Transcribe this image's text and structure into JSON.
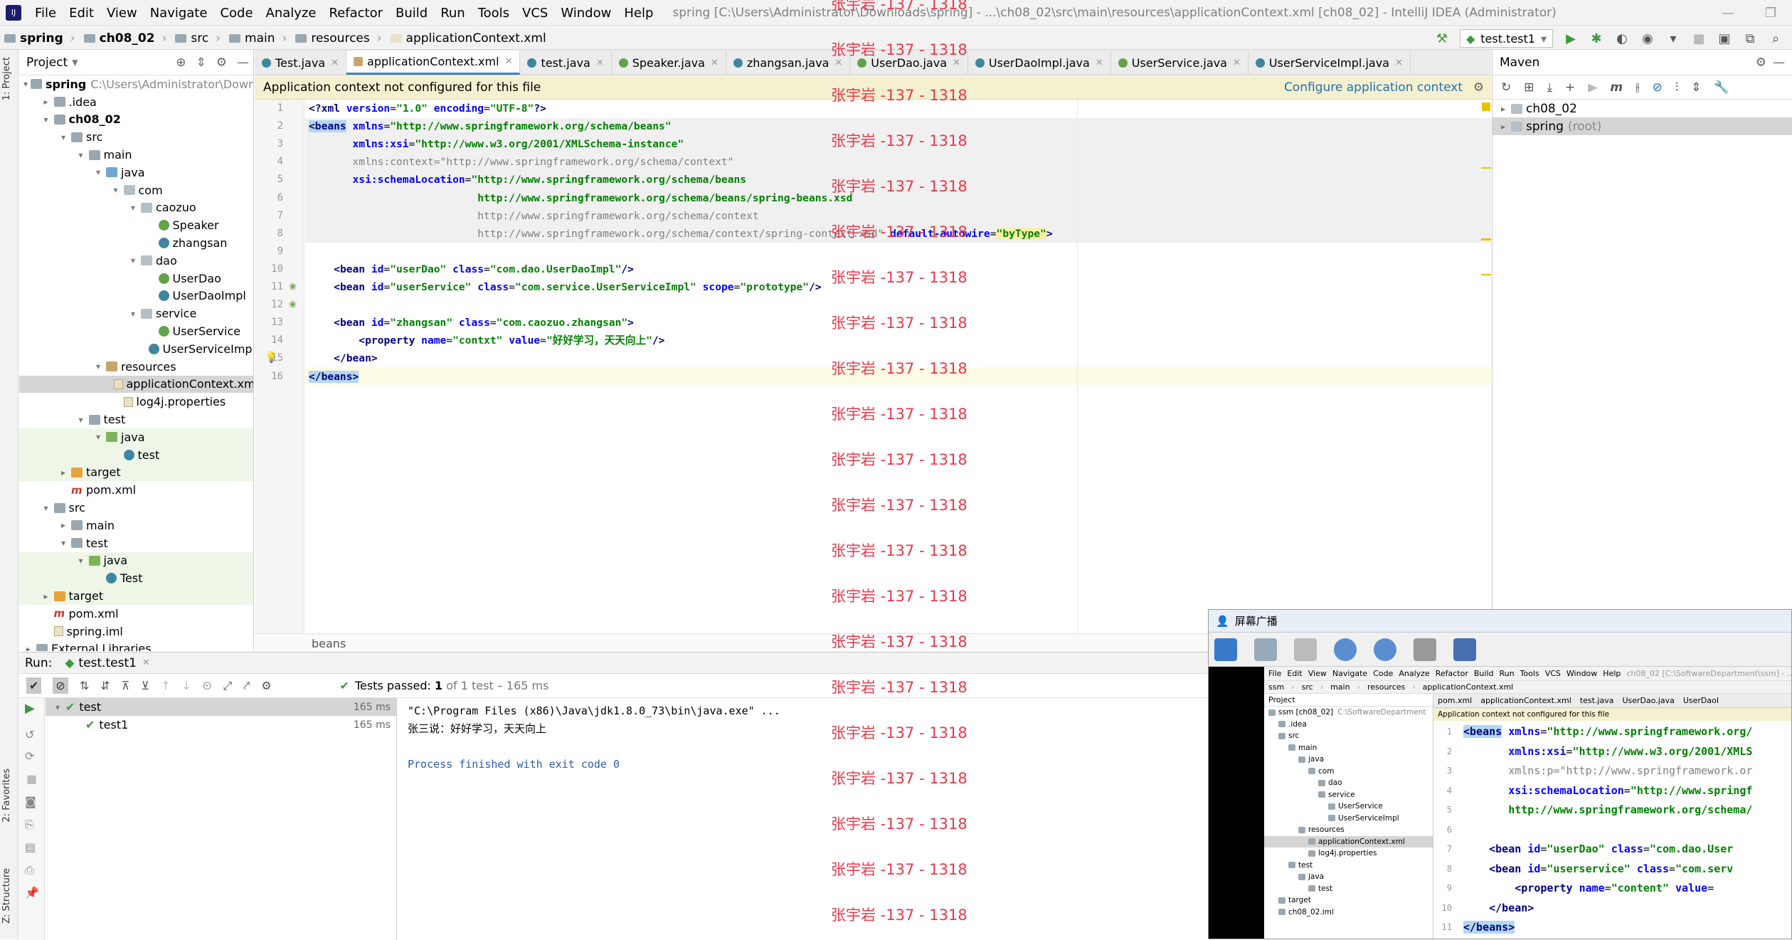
{
  "menu": {
    "items": [
      "File",
      "Edit",
      "View",
      "Navigate",
      "Code",
      "Analyze",
      "Refactor",
      "Build",
      "Run",
      "Tools",
      "VCS",
      "Window",
      "Help"
    ],
    "window_title": "spring [C:\\Users\\Administrator\\Downloads\\spring] - ...\\ch08_02\\src\\main\\resources\\applicationContext.xml [ch08_02] - IntelliJ IDEA (Administrator)"
  },
  "navbar": {
    "crumbs": [
      "spring",
      "ch08_02",
      "src",
      "main",
      "resources",
      "applicationContext.xml"
    ],
    "run_config": "test.test1"
  },
  "project": {
    "header": "Project",
    "tree": [
      {
        "label": "spring",
        "extra": "C:\\Users\\Administrator\\Downloads",
        "indent": 0,
        "icon": "folder",
        "arrow": "▾",
        "bold": true
      },
      {
        "label": ".idea",
        "indent": 1,
        "icon": "folder",
        "arrow": "▸"
      },
      {
        "label": "ch08_02",
        "indent": 1,
        "icon": "folder",
        "arrow": "▾",
        "bold": true
      },
      {
        "label": "src",
        "indent": 2,
        "icon": "folder",
        "arrow": "▾"
      },
      {
        "label": "main",
        "indent": 3,
        "icon": "folder",
        "arrow": "▾"
      },
      {
        "label": "java",
        "indent": 4,
        "icon": "folder src",
        "arrow": "▾"
      },
      {
        "label": "com",
        "indent": 5,
        "icon": "pkg",
        "arrow": "▾"
      },
      {
        "label": "caozuo",
        "indent": 6,
        "icon": "pkg",
        "arrow": "▾"
      },
      {
        "label": "Speaker",
        "indent": 7,
        "icon": "int",
        "arrow": ""
      },
      {
        "label": "zhangsan",
        "indent": 7,
        "icon": "cls",
        "arrow": ""
      },
      {
        "label": "dao",
        "indent": 6,
        "icon": "pkg",
        "arrow": "▾"
      },
      {
        "label": "UserDao",
        "indent": 7,
        "icon": "int",
        "arrow": ""
      },
      {
        "label": "UserDaoImpl",
        "indent": 7,
        "icon": "cls",
        "arrow": ""
      },
      {
        "label": "service",
        "indent": 6,
        "icon": "pkg",
        "arrow": "▾"
      },
      {
        "label": "UserService",
        "indent": 7,
        "icon": "int",
        "arrow": ""
      },
      {
        "label": "UserServiceImpl",
        "indent": 7,
        "icon": "cls",
        "arrow": ""
      },
      {
        "label": "resources",
        "indent": 4,
        "icon": "folder res",
        "arrow": "▾"
      },
      {
        "label": "applicationContext.xml",
        "indent": 5,
        "icon": "file",
        "arrow": "",
        "sel": true
      },
      {
        "label": "log4j.properties",
        "indent": 5,
        "icon": "file",
        "arrow": ""
      },
      {
        "label": "test",
        "indent": 3,
        "icon": "folder",
        "arrow": "▾"
      },
      {
        "label": "java",
        "indent": 4,
        "icon": "folder tst",
        "arrow": "▾",
        "green": true
      },
      {
        "label": "test",
        "indent": 5,
        "icon": "cls",
        "arrow": "",
        "green": true
      },
      {
        "label": "target",
        "indent": 2,
        "icon": "folder tgt",
        "arrow": "▸",
        "green": true
      },
      {
        "label": "pom.xml",
        "indent": 2,
        "icon": "mvn",
        "arrow": ""
      },
      {
        "label": "src",
        "indent": 1,
        "icon": "folder",
        "arrow": "▾"
      },
      {
        "label": "main",
        "indent": 2,
        "icon": "folder",
        "arrow": "▸"
      },
      {
        "label": "test",
        "indent": 2,
        "icon": "folder",
        "arrow": "▾"
      },
      {
        "label": "java",
        "indent": 3,
        "icon": "folder tst",
        "arrow": "▾",
        "green": true
      },
      {
        "label": "Test",
        "indent": 4,
        "icon": "cls",
        "arrow": "",
        "green": true
      },
      {
        "label": "target",
        "indent": 1,
        "icon": "folder tgt",
        "arrow": "▸",
        "green": true
      },
      {
        "label": "pom.xml",
        "indent": 1,
        "icon": "mvn",
        "arrow": ""
      },
      {
        "label": "spring.iml",
        "indent": 1,
        "icon": "file",
        "arrow": ""
      },
      {
        "label": "External Libraries",
        "indent": 0,
        "icon": "folder",
        "arrow": "▸"
      }
    ]
  },
  "tabs": [
    {
      "label": "Test.java",
      "color": "#3e86a0"
    },
    {
      "label": "applicationContext.xml",
      "color": "#c9a56a",
      "active": true
    },
    {
      "label": "test.java",
      "color": "#3e86a0"
    },
    {
      "label": "Speaker.java",
      "color": "#62a348"
    },
    {
      "label": "zhangsan.java",
      "color": "#3e86a0"
    },
    {
      "label": "UserDao.java",
      "color": "#62a348"
    },
    {
      "label": "UserDaoImpl.java",
      "color": "#3e86a0"
    },
    {
      "label": "UserService.java",
      "color": "#62a348"
    },
    {
      "label": "UserServiceImpl.java",
      "color": "#3e86a0"
    }
  ],
  "notice": {
    "text": "Application context not configured for this file",
    "link": "Configure application context"
  },
  "editor": {
    "breadcrumb": "beans",
    "lines": [
      "<span class=\"pi\">&lt;?xml </span><span class=\"at\">version</span>=<span class=\"vl\">\"1.0\"</span> <span class=\"at\">encoding</span>=<span class=\"vl\">\"UTF-8\"</span><span class=\"pi\">?&gt;</span>",
      "<span class=\"tg hlt\">&lt;beans</span> <span class=\"at\">xmlns</span>=<span class=\"vl\">\"http://www.springframework.org/schema/beans\"</span>",
      "       <span class=\"at\">xmlns:xsi</span>=<span class=\"vl\">\"http://www.w3.org/2001/XMLSchema-instance\"</span>",
      "       <span class=\"gr\">xmlns:context=\"http://www.springframework.org/schema/context\"</span>",
      "       <span class=\"at\">xsi:schemaLocation</span>=<span class=\"vl\">\"http://www.springframework.org/schema/beans</span>",
      "                           <span class=\"vl\">http://www.springframework.org/schema/beans/spring-beans.xsd</span>",
      "                           <span class=\"gr\">http://www.springframework.org/schema/context</span>",
      "                           <span class=\"gr\">http://www.springframework.org/schema/context/spring-context.xsd\"</span> <span class=\"at\">default-autowire</span>=<span class=\"vl hly\">\"byType\"</span><span class=\"tg\">&gt;</span>",
      "",
      "    <span class=\"tg\">&lt;bean </span><span class=\"at\">id</span>=<span class=\"vl\">\"userDao\"</span> <span class=\"at\">class</span>=<span class=\"vl\">\"com.dao.UserDaoImpl\"</span><span class=\"tg\">/&gt;</span>",
      "    <span class=\"tg\">&lt;bean </span><span class=\"at\">id</span>=<span class=\"vl\">\"userService\"</span> <span class=\"at\">class</span>=<span class=\"vl\">\"com.service.UserServiceImpl\"</span> <span class=\"at\">scope</span>=<span class=\"vl\">\"prototype\"</span><span class=\"tg\">/&gt;</span>",
      "",
      "    <span class=\"tg\">&lt;bean </span><span class=\"at\">id</span>=<span class=\"vl\">\"zhangsan\"</span> <span class=\"at\">class</span>=<span class=\"vl\">\"com.caozuo.zhangsan\"</span><span class=\"tg\">&gt;</span>",
      "        <span class=\"tg\">&lt;property </span><span class=\"at\">name</span>=<span class=\"vl\">\"contxt\"</span> <span class=\"at\">value</span>=<span class=\"vl\">\"好好学习，天天向上\"</span><span class=\"tg\">/&gt;</span>",
      "    <span class=\"tg\">&lt;/bean&gt;</span>",
      "<span class=\"tg hlt\">&lt;/beans&gt;</span>"
    ]
  },
  "maven": {
    "header": "Maven",
    "items": [
      {
        "label": "ch08_02",
        "extra": ""
      },
      {
        "label": "spring",
        "extra": "(root)",
        "sel": true
      }
    ]
  },
  "run": {
    "label": "Run:",
    "tab": "test.test1",
    "status": "Tests passed:",
    "status_count": "1",
    "status_rest": "of 1 test – 165 ms",
    "tree": [
      {
        "label": "test",
        "time": "165 ms",
        "sel": true,
        "indent": 0
      },
      {
        "label": "test1",
        "time": "165 ms",
        "indent": 1
      }
    ],
    "console": [
      {
        "text": "\"C:\\Program Files (x86)\\Java\\jdk1.8.0_73\\bin\\java.exe\" ...",
        "cls": ""
      },
      {
        "text": "张三说：好好学习，天天向上",
        "cls": ""
      },
      {
        "text": "",
        "cls": ""
      },
      {
        "text": "Process finished with exit code 0",
        "cls": "blue"
      }
    ]
  },
  "left_strip": {
    "project_tab": "1: Project",
    "favorites_tab": "2: Favorites",
    "structure_tab": "Z: Structure"
  },
  "popup": {
    "title": "屏幕广播",
    "menu": [
      "File",
      "Edit",
      "View",
      "Navigate",
      "Code",
      "Analyze",
      "Refactor",
      "Build",
      "Run",
      "Tools",
      "VCS",
      "Window",
      "Help"
    ],
    "window_title": "ch08_02 [C:\\SoftwareDepartment\\ssm] - ...",
    "crumbs": [
      "ssm",
      "src",
      "main",
      "resources",
      "applicationContext.xml"
    ],
    "project_header": "Project",
    "tree": [
      {
        "label": "ssm [ch08_02]",
        "extra": "C:\\SoftwareDepartment",
        "indent": 0
      },
      {
        "label": ".idea",
        "indent": 1
      },
      {
        "label": "src",
        "indent": 1
      },
      {
        "label": "main",
        "indent": 2
      },
      {
        "label": "java",
        "indent": 3
      },
      {
        "label": "com",
        "indent": 4
      },
      {
        "label": "dao",
        "indent": 5
      },
      {
        "label": "service",
        "indent": 5
      },
      {
        "label": "UserService",
        "indent": 6
      },
      {
        "label": "UserServiceImpl",
        "indent": 6
      },
      {
        "label": "resources",
        "indent": 3
      },
      {
        "label": "applicationContext.xml",
        "indent": 4,
        "sel": true
      },
      {
        "label": "log4j.properties",
        "indent": 4
      },
      {
        "label": "test",
        "indent": 2
      },
      {
        "label": "java",
        "indent": 3
      },
      {
        "label": "test",
        "indent": 4
      },
      {
        "label": "target",
        "indent": 1
      },
      {
        "label": "ch08_02.iml",
        "indent": 1
      }
    ],
    "tabs": [
      "pom.xml",
      "applicationContext.xml",
      "test.java",
      "UserDao.java",
      "UserDaoI"
    ],
    "notice": "Application context not configured for this file",
    "lines": [
      "<span class=\"tg hlt\">&lt;beans</span> <span class=\"at\">xmlns</span>=<span class=\"vl\">\"http://www.springframework.org/</span>",
      "       <span class=\"at\">xmlns:xsi</span>=<span class=\"vl\">\"http://www.w3.org/2001/XMLS</span>",
      "       <span class=\"gr\">xmlns:p=\"http://www.springframework.or</span>",
      "       <span class=\"at\">xsi:schemaLocation</span>=<span class=\"vl\">\"http://www.springf</span>",
      "       <span class=\"vl\">http://www.springframework.org/schema/</span>",
      "",
      "    <span class=\"tg\">&lt;bean </span><span class=\"at\">id</span>=<span class=\"vl\">\"userDao\"</span> <span class=\"at\">class</span>=<span class=\"vl\">\"com.dao.User</span>",
      "    <span class=\"tg\">&lt;bean </span><span class=\"at\">id</span>=<span class=\"vl\">\"userservice\"</span> <span class=\"at\">class</span>=<span class=\"vl\">\"com.serv</span>",
      "        <span class=\"tg\">&lt;property </span><span class=\"at\">name</span>=<span class=\"vl\">\"content\"</span> <span class=\"at\">value</span>=",
      "    <span class=\"tg\">&lt;/bean&gt;</span>",
      "<span class=\"tg hlt\">&lt;/beans&gt;</span>"
    ]
  },
  "watermark": "张宇岩 -137 - 1318",
  "colors": {
    "accent": "#4083c9",
    "watermark": "#e8384a",
    "notice_bg": "#f5f0d0",
    "selection": "#d5d5d5"
  }
}
